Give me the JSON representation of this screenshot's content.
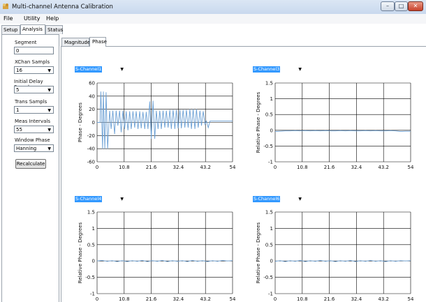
{
  "window": {
    "title": "Multi-channel Antenna Calibration"
  },
  "menu": [
    "File",
    "Utility",
    "Help"
  ],
  "left_tabs": [
    "Setup",
    "Analysis",
    "Status"
  ],
  "left_active_tab": "Analysis",
  "fields": {
    "segment": {
      "label": "Segment",
      "value": "0"
    },
    "xchan": {
      "label": "XChan Sampls",
      "value": "16"
    },
    "initial_delay": {
      "label": "Initial Delay Sampls",
      "value": "5"
    },
    "trans": {
      "label": "Trans Sampls",
      "value": "1"
    },
    "meas": {
      "label": "Meas Intervals",
      "value": "55"
    },
    "window_phase": {
      "label": "Window Phase",
      "value": "Hanning"
    }
  },
  "recalc_label": "Recalculate",
  "main_tabs": [
    "Magnitude",
    "Phase"
  ],
  "main_active_tab": "Phase",
  "colors": {
    "line": "#6a9fd4",
    "select_highlight": "#3399ff",
    "grid": "#000000"
  },
  "chart_data": [
    {
      "type": "line",
      "channel": "S-Channel1",
      "ylabel": "Phase - Degrees",
      "xticks": [
        "0",
        "10.8",
        "21.6",
        "32.4",
        "43.2",
        "54"
      ],
      "yticks": [
        "60",
        "40",
        "20",
        "0",
        "-20",
        "-40",
        "-60"
      ],
      "xlim": [
        0,
        54
      ],
      "ylim": [
        -60,
        60
      ],
      "series": [
        {
          "x": [
            0,
            1.2,
            1.5,
            2.2,
            2.5,
            3.1,
            3.6,
            4.2,
            5.0,
            5.6,
            6.3,
            7.0,
            7.6,
            8.3,
            9.0,
            9.6,
            10.3,
            11.0,
            11.6,
            12.3,
            13.0,
            13.6,
            14.3,
            15.0,
            15.6,
            16.3,
            17.0,
            17.6,
            18.3,
            19.0,
            19.6,
            20.3,
            21.0,
            21.6,
            22.3,
            23.0,
            23.6,
            24.3,
            25.0,
            25.6,
            26.3,
            27.0,
            27.6,
            28.3,
            29.0,
            29.6,
            30.3,
            31.0,
            31.6,
            32.3,
            33.0,
            33.6,
            34.3,
            35.0,
            35.6,
            36.3,
            37.0,
            37.6,
            38.3,
            39.0,
            39.6,
            40.3,
            41.0,
            41.6,
            42.3,
            43.0,
            43.6,
            44.3,
            45.0,
            54
          ],
          "y": [
            0,
            0,
            47,
            -40,
            47,
            -40,
            46,
            -40,
            18,
            -10,
            18,
            -18,
            18,
            -5,
            18,
            -15,
            18,
            -10,
            17,
            -12,
            17,
            -10,
            17,
            -8,
            17,
            -10,
            17,
            -9,
            16,
            -10,
            16,
            -10,
            32,
            -25,
            33,
            -25,
            18,
            -10,
            18,
            -10,
            18,
            -8,
            18,
            -8,
            19,
            -10,
            19,
            -10,
            19,
            -9,
            19,
            -9,
            19,
            -8,
            19,
            -8,
            20,
            -10,
            20,
            -10,
            20,
            -8,
            18,
            -5,
            17,
            -3,
            2,
            -8,
            2,
            2
          ]
        }
      ]
    },
    {
      "type": "line",
      "channel": "S-Channel3",
      "ylabel": "Relative Phase - Degrees",
      "xticks": [
        "0",
        "10.8",
        "21.6",
        "32.4",
        "43.2",
        "54"
      ],
      "yticks": [
        "1.5",
        "1",
        "0.5",
        "0",
        "-0.5",
        "-1"
      ],
      "xlim": [
        0,
        54
      ],
      "ylim": [
        -1,
        1.5
      ],
      "series": [
        {
          "x": [
            0,
            2,
            4,
            6,
            8,
            10,
            12,
            14,
            16,
            18,
            20,
            22,
            24,
            26,
            28,
            30,
            32,
            34,
            36,
            38,
            40,
            42,
            44,
            46,
            48,
            50,
            52,
            54
          ],
          "y": [
            -0.04,
            -0.03,
            -0.02,
            -0.02,
            -0.01,
            -0.02,
            -0.01,
            -0.02,
            -0.01,
            -0.02,
            -0.01,
            -0.02,
            -0.02,
            -0.01,
            -0.02,
            -0.01,
            -0.02,
            -0.02,
            -0.01,
            -0.02,
            -0.01,
            -0.02,
            -0.02,
            -0.01,
            -0.02,
            -0.04,
            -0.03,
            -0.03
          ]
        }
      ]
    },
    {
      "type": "line",
      "channel": "S-Channel4",
      "ylabel": "Relative Phase - Degrees",
      "xticks": [
        "0",
        "10.8",
        "21.6",
        "32.4",
        "43.2",
        "54"
      ],
      "yticks": [
        "1.5",
        "1",
        "0.5",
        "0",
        "-0.5",
        "-1"
      ],
      "xlim": [
        0,
        54
      ],
      "ylim": [
        -1,
        1.5
      ],
      "series": [
        {
          "x": [
            0,
            2,
            4,
            6,
            8,
            10,
            12,
            14,
            16,
            18,
            20,
            22,
            24,
            26,
            28,
            30,
            32,
            34,
            36,
            38,
            40,
            42,
            44,
            46,
            48,
            50,
            52,
            54
          ],
          "y": [
            0.0,
            0.02,
            -0.01,
            0.01,
            -0.02,
            0.01,
            -0.02,
            0.01,
            -0.01,
            0.02,
            -0.02,
            0.01,
            -0.01,
            0.02,
            -0.02,
            0.01,
            -0.01,
            0.01,
            -0.02,
            0.02,
            -0.01,
            0.01,
            -0.02,
            0.01,
            -0.01,
            0.02,
            0.0,
            0.01
          ]
        }
      ]
    },
    {
      "type": "line",
      "channel": "S-Channel6",
      "ylabel": "Relative Phase - Degrees",
      "xticks": [
        "0",
        "10.8",
        "21.6",
        "32.4",
        "43.2",
        "54"
      ],
      "yticks": [
        "1.5",
        "1",
        "0.5",
        "0",
        "-0.5",
        "-1"
      ],
      "xlim": [
        0,
        54
      ],
      "ylim": [
        -1,
        1.5
      ],
      "series": [
        {
          "x": [
            0,
            2,
            4,
            6,
            8,
            10,
            12,
            14,
            16,
            18,
            20,
            22,
            24,
            26,
            28,
            30,
            32,
            34,
            36,
            38,
            40,
            42,
            44,
            46,
            48,
            50,
            52,
            54
          ],
          "y": [
            -0.01,
            0.01,
            -0.02,
            0.01,
            -0.01,
            0.02,
            -0.02,
            0.01,
            -0.01,
            0.02,
            -0.01,
            0.01,
            -0.02,
            0.01,
            -0.01,
            0.02,
            -0.02,
            0.01,
            -0.01,
            0.02,
            -0.01,
            0.01,
            -0.02,
            0.01,
            -0.01,
            0.01,
            0.0,
            0.01
          ]
        }
      ]
    }
  ]
}
